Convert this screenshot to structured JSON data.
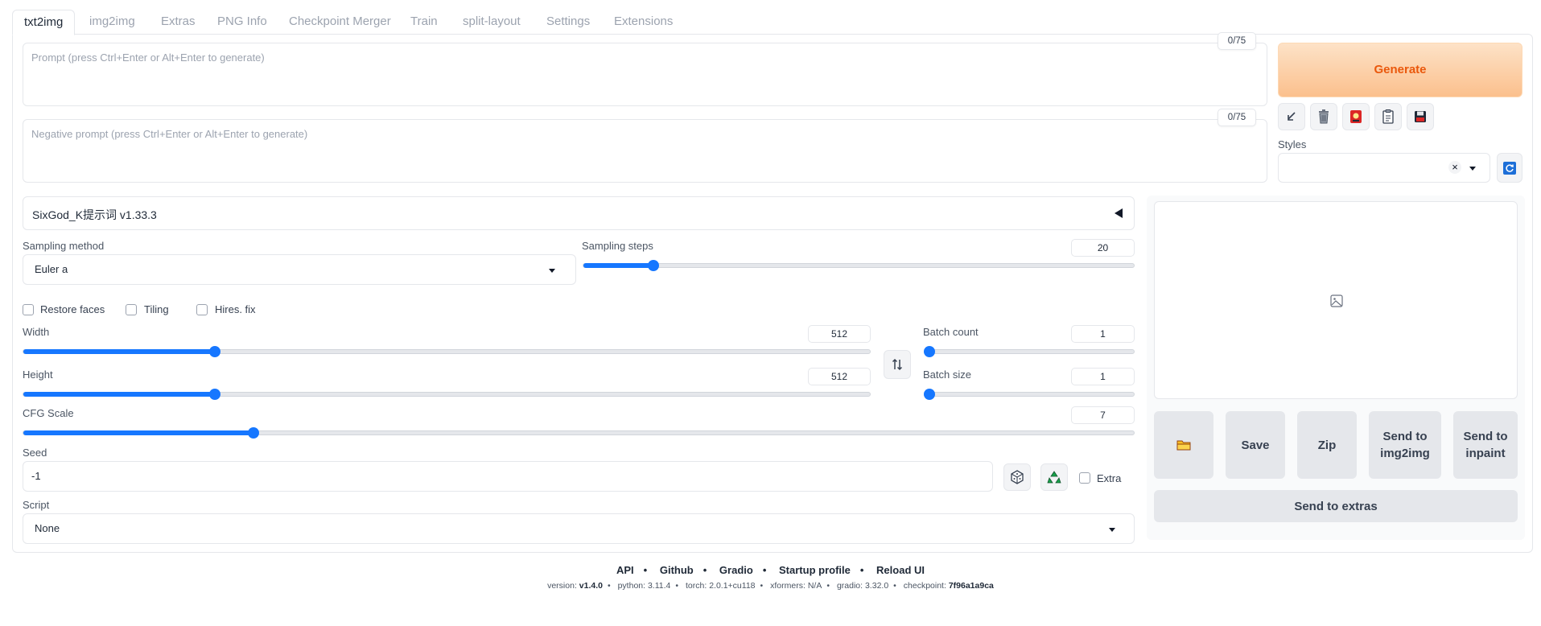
{
  "tabs": [
    "txt2img",
    "img2img",
    "Extras",
    "PNG Info",
    "Checkpoint Merger",
    "Train",
    "split-layout",
    "Settings",
    "Extensions"
  ],
  "prompt": {
    "placeholder": "Prompt (press Ctrl+Enter or Alt+Enter to generate)",
    "counter": "0/75"
  },
  "negative_prompt": {
    "placeholder": "Negative prompt (press Ctrl+Enter or Alt+Enter to generate)",
    "counter": "0/75"
  },
  "generate_label": "Generate",
  "toolbar_icons": [
    "arrow-down-left-icon",
    "trash-icon",
    "red-card-icon",
    "clipboard-icon",
    "save-disk-icon"
  ],
  "styles": {
    "label": "Styles",
    "value": "",
    "clear": "×"
  },
  "accordion": {
    "title": "SixGod_K提示词 v1.33.3"
  },
  "sampling_method": {
    "label": "Sampling method",
    "value": "Euler a"
  },
  "sampling_steps": {
    "label": "Sampling steps",
    "value": "20",
    "min": 1,
    "max": 150,
    "current": 20
  },
  "checkboxes": {
    "restore_faces": "Restore faces",
    "tiling": "Tiling",
    "hires_fix": "Hires. fix"
  },
  "width": {
    "label": "Width",
    "value": "512",
    "min": 64,
    "max": 2048,
    "current": 512
  },
  "height": {
    "label": "Height",
    "value": "512",
    "min": 64,
    "max": 2048,
    "current": 512
  },
  "batch_count": {
    "label": "Batch count",
    "value": "1",
    "min": 1,
    "max": 100,
    "current": 1
  },
  "batch_size": {
    "label": "Batch size",
    "value": "1",
    "min": 1,
    "max": 8,
    "current": 1
  },
  "cfg_scale": {
    "label": "CFG Scale",
    "value": "7",
    "min": 1,
    "max": 30,
    "current": 7
  },
  "seed": {
    "label": "Seed",
    "value": "-1",
    "extra": "Extra"
  },
  "script": {
    "label": "Script",
    "value": "None"
  },
  "gallery_buttons": {
    "open_folder": "folder-icon",
    "save": "Save",
    "zip": "Zip",
    "send_img2img": "Send to img2img",
    "send_inpaint": "Send to inpaint",
    "send_extras": "Send to extras"
  },
  "footer": {
    "links": [
      "API",
      "Github",
      "Gradio",
      "Startup profile",
      "Reload UI"
    ],
    "version_label": "version:",
    "version": "v1.4.0",
    "python_label": "python:",
    "python": "3.11.4",
    "torch_label": "torch:",
    "torch": "2.0.1+cu118",
    "xformers_label": "xformers:",
    "xformers": "N/A",
    "gradio_label": "gradio:",
    "gradio": "3.32.0",
    "checkpoint_label": "checkpoint:",
    "checkpoint": "7f96a1a9ca"
  },
  "colors": {
    "accent": "#1677ff",
    "generate_text": "#ea580c",
    "generate_bg": "#fbc08d"
  }
}
